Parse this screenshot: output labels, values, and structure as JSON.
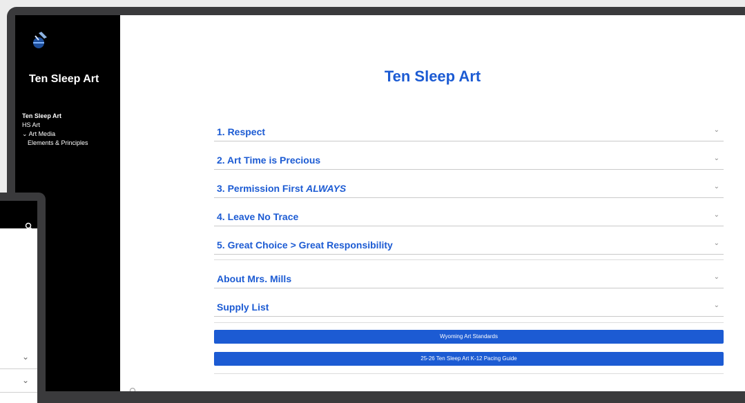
{
  "site": {
    "title": "Ten Sleep Art"
  },
  "nav": {
    "items": [
      {
        "label": "Ten Sleep Art",
        "active": true
      },
      {
        "label": "HS Art"
      },
      {
        "label": "Art Media",
        "expanded": true
      },
      {
        "label": "Elements & Principles"
      }
    ]
  },
  "page": {
    "title": "Ten Sleep Art"
  },
  "accordion": [
    {
      "label": "1. Respect"
    },
    {
      "label": "2. Art Time is Precious"
    },
    {
      "label": "3. Permission First ALWAYS"
    },
    {
      "label": "4. Leave No Trace"
    },
    {
      "label": "5. Great Choice > Great Responsibility"
    },
    {
      "label": "About Mrs. Mills"
    },
    {
      "label": "Supply List"
    }
  ],
  "buttons": [
    {
      "label": "Wyoming Art Standards"
    },
    {
      "label": "25-26 Ten Sleep Art K-12 Pacing Guide"
    }
  ],
  "colors": {
    "accent": "#1c5bd3",
    "sidebar_bg": "#000000",
    "frame": "#3a3a3c"
  }
}
